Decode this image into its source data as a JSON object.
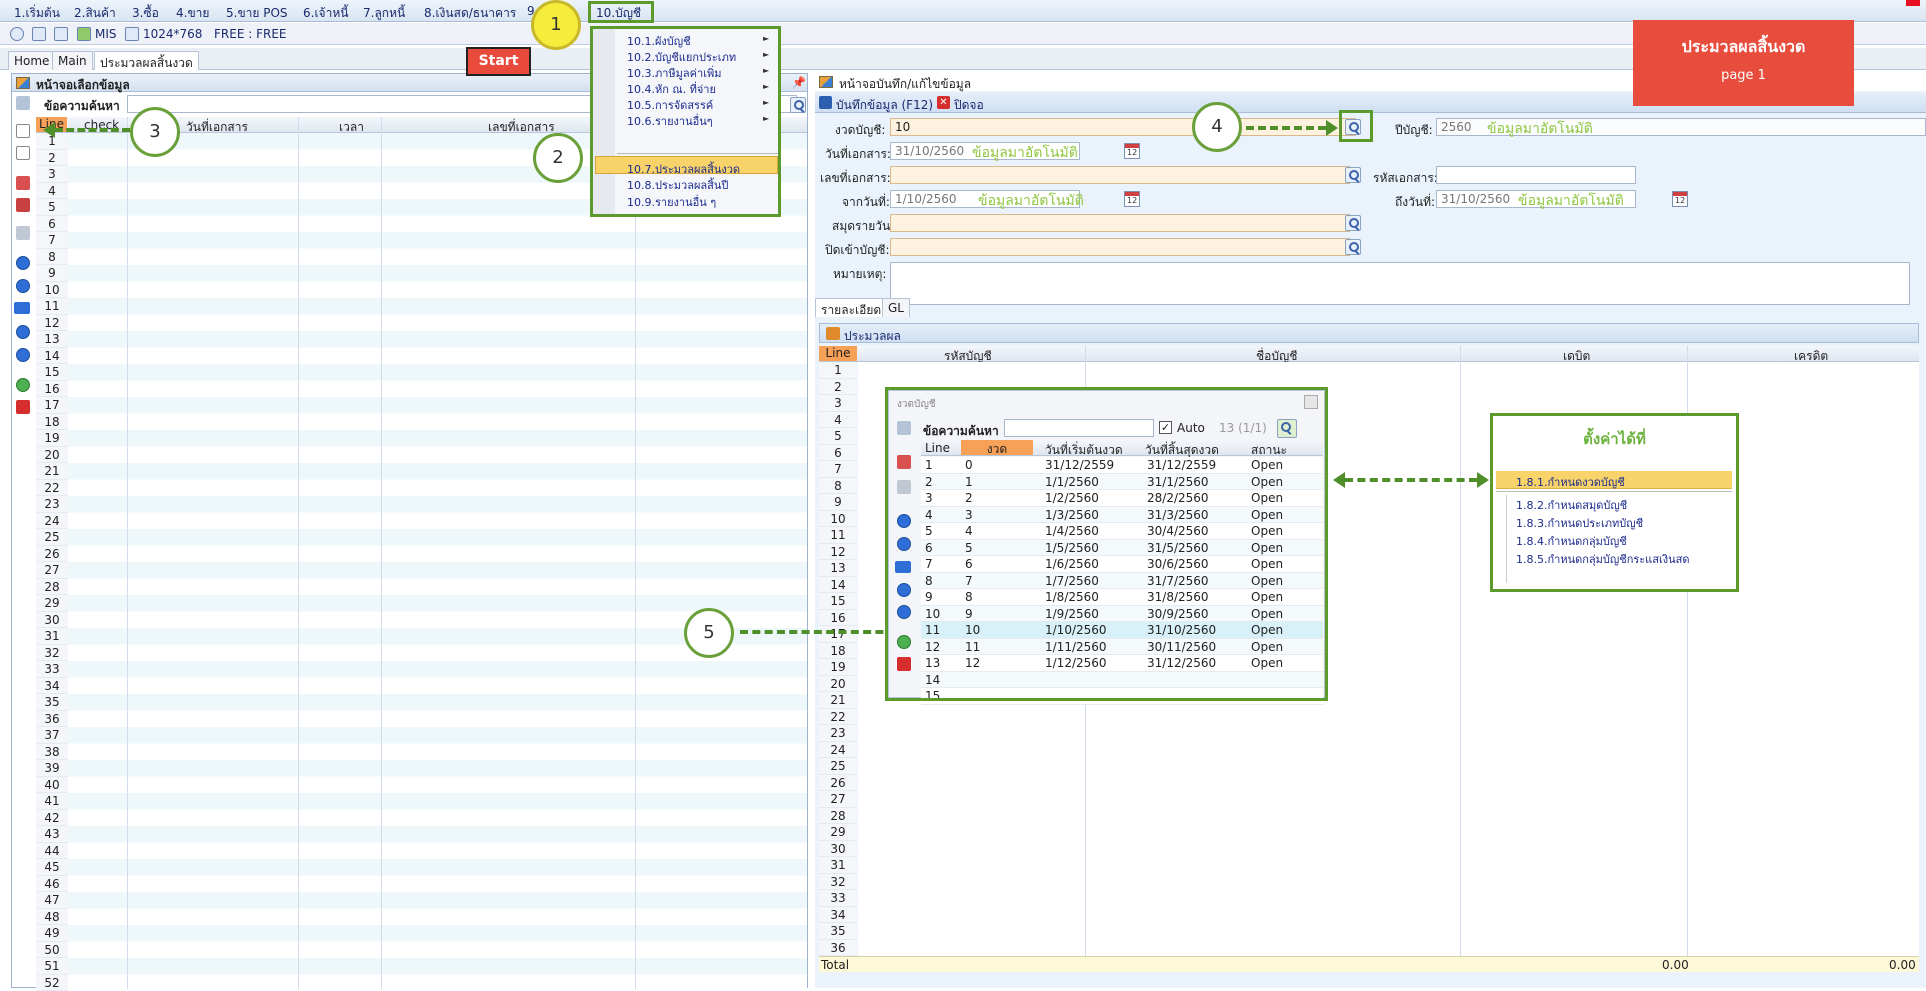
{
  "menubar": [
    "1.เริ่มต้น",
    "2.สินค้า",
    "3.ซื้อ",
    "4.ขาย",
    "5.ขาย POS",
    "6.เจ้าหนี้",
    "7.ลูกหนี้",
    "8.เงินสด/ธนาคาร",
    "9",
    "10.บัญชี"
  ],
  "toolbar": {
    "app": "MIS",
    "resolution": "1024*768",
    "license": "FREE : FREE"
  },
  "tabs": [
    "Home",
    "Main",
    "ประมวลผลสิ้นงวด"
  ],
  "start_button": "Start",
  "banner": {
    "title": "ประมวลผลสิ้นงวด",
    "page": "page 1"
  },
  "menu10": [
    {
      "label": "10.1.ผังบัญชี",
      "arrow": "►"
    },
    {
      "label": "10.2.บัญชีแยกประเภท",
      "arrow": "►"
    },
    {
      "label": "10.3.ภาษีมูลค่าเพิ่ม",
      "arrow": "►"
    },
    {
      "label": "10.4.หัก ณ. ที่จ่าย",
      "arrow": "►"
    },
    {
      "label": "10.5.การจัดสรรค์",
      "arrow": "►"
    },
    {
      "label": "10.6.รายงานอื่นๆ",
      "arrow": "►"
    },
    {
      "label": "10.7.ประมวลผลสิ้นงวด",
      "arrow": ""
    },
    {
      "label": "10.8.ประมวลผลสิ้นปี",
      "arrow": ""
    },
    {
      "label": "10.9.รายงานอื่น ๆ",
      "arrow": ""
    }
  ],
  "callouts": [
    "1",
    "2",
    "3",
    "4",
    "5"
  ],
  "left_panel": {
    "title": "หน้าจอเลือกข้อมูล",
    "search_label": "ข้อความค้นหา",
    "pin": "📌",
    "columns": [
      "Line",
      "check",
      "วันที่เอกสาร",
      "เวลา",
      "เลขที่เอกสาร"
    ],
    "rows": [
      "1",
      "2",
      "3",
      "4",
      "5",
      "6",
      "7",
      "8",
      "9",
      "10",
      "11",
      "12",
      "13",
      "14",
      "15",
      "16",
      "17",
      "18",
      "19",
      "20",
      "21",
      "22",
      "23",
      "24",
      "25",
      "26",
      "27",
      "28",
      "29",
      "30",
      "31",
      "32",
      "33",
      "34",
      "35",
      "36",
      "37",
      "38",
      "39",
      "40",
      "41",
      "42",
      "43",
      "44",
      "45",
      "46",
      "47",
      "48",
      "49",
      "50",
      "51",
      "52"
    ]
  },
  "right_panel": {
    "title": "หน้าจอบันทึก/แก้ไขข้อมูล",
    "save_label": "บันทึกข้อมูล (F12)",
    "close_label": "ปิดจอ",
    "fields": {
      "period_label": "งวดบัญชี:",
      "period_value": "10",
      "year_label": "ปีบัญชี:",
      "year_value": "2560",
      "year_note": "ข้อมูลมาอัตโนมัติ",
      "docdate_label": "วันที่เอกสาร:",
      "docdate_value": "31/10/2560",
      "docdate_note": "ข้อมูลมาอัตโนมัติ",
      "docno_label": "เลขที่เอกสาร:",
      "doccode_label": "รหัสเอกสาร:",
      "from_label": "จากวันที่:",
      "from_value": "1/10/2560",
      "from_note": "ข้อมูลมาอัตโนมัติ",
      "to_label": "ถึงวันที่:",
      "to_value": "31/10/2560",
      "to_note": "ข้อมูลมาอัตโนมัติ",
      "journal_label": "สมุดรายวัน:",
      "closeacct_label": "ปิดเข้าบัญชี:",
      "remark_label": "หมายเหตุ:"
    },
    "subtabs": [
      "รายละเอียด",
      "GL"
    ],
    "process_label": "ประมวลผล",
    "columns": [
      "Line",
      "รหัสบัญชี",
      "ชื่อบัญชี",
      "เดบิต",
      "เครดิต"
    ],
    "rows": [
      "1",
      "2",
      "3",
      "4",
      "5",
      "6",
      "7",
      "8",
      "9",
      "10",
      "11",
      "12",
      "13",
      "14",
      "15",
      "16",
      "17",
      "18",
      "19",
      "20",
      "21",
      "22",
      "23",
      "24",
      "25",
      "26",
      "27",
      "28",
      "29",
      "30",
      "31",
      "32",
      "33",
      "34",
      "35",
      "36"
    ],
    "total_label": "Total",
    "total_debit": "0.00",
    "total_credit": "0.00"
  },
  "popup": {
    "title": "งวดบัญชี",
    "search_label": "ข้อความค้นหา",
    "auto_label": "Auto",
    "count": "13 (1/1)",
    "columns": [
      "Line",
      "งวด",
      "วันที่เริ่มต้นงวด",
      "วันที่สิ้นสุดงวด",
      "สถานะ"
    ],
    "rows": [
      [
        "1",
        "0",
        "31/12/2559",
        "31/12/2559",
        "Open"
      ],
      [
        "2",
        "1",
        "1/1/2560",
        "31/1/2560",
        "Open"
      ],
      [
        "3",
        "2",
        "1/2/2560",
        "28/2/2560",
        "Open"
      ],
      [
        "4",
        "3",
        "1/3/2560",
        "31/3/2560",
        "Open"
      ],
      [
        "5",
        "4",
        "1/4/2560",
        "30/4/2560",
        "Open"
      ],
      [
        "6",
        "5",
        "1/5/2560",
        "31/5/2560",
        "Open"
      ],
      [
        "7",
        "6",
        "1/6/2560",
        "30/6/2560",
        "Open"
      ],
      [
        "8",
        "7",
        "1/7/2560",
        "31/7/2560",
        "Open"
      ],
      [
        "9",
        "8",
        "1/8/2560",
        "31/8/2560",
        "Open"
      ],
      [
        "10",
        "9",
        "1/9/2560",
        "30/9/2560",
        "Open"
      ],
      [
        "11",
        "10",
        "1/10/2560",
        "31/10/2560",
        "Open"
      ],
      [
        "12",
        "11",
        "1/11/2560",
        "30/11/2560",
        "Open"
      ],
      [
        "13",
        "12",
        "1/12/2560",
        "31/12/2560",
        "Open"
      ],
      [
        "14",
        "",
        "",
        "",
        ""
      ],
      [
        "15",
        "",
        "",
        "",
        ""
      ]
    ]
  },
  "settings_box": {
    "title": "ตั้งค่าได้ที่",
    "items": [
      "1.8.1.กำหนดงวดบัญชี",
      "1.8.2.กำหนดสมุดบัญชี",
      "1.8.3.กำหนดประเภทบัญชี",
      "1.8.4.กำหนดกลุ่มบัญชี",
      "1.8.5.กำหนดกลุ่มบัญชีกระแสเงินสด"
    ]
  }
}
